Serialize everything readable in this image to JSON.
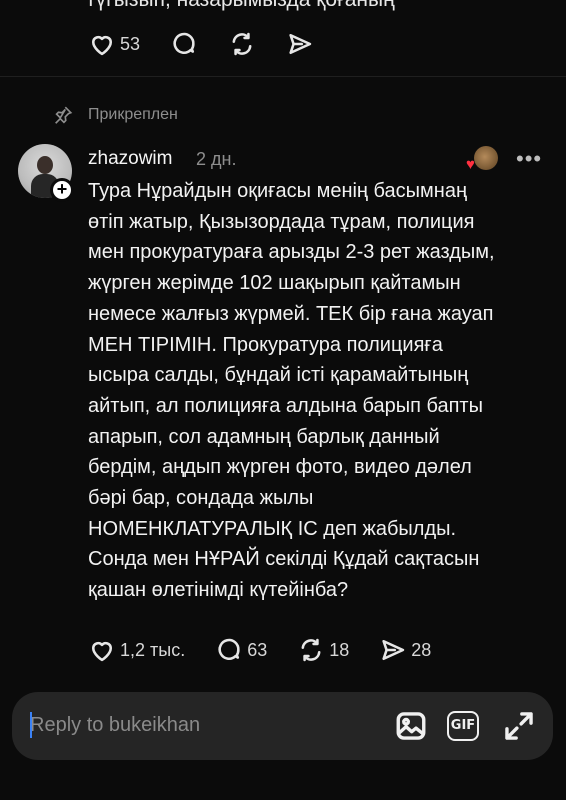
{
  "previous_post": {
    "cut_text": "түгызып, назарымызда қоғаның",
    "likes": "53"
  },
  "pinned_label": "Прикреплен",
  "post": {
    "username": "zhazowim",
    "time": "2 дн.",
    "text": "Тура Нұрайдын оқиғасы менің басымнаң\nөтіп жатыр, Қызызордада тұрам, полиция\nмен прокуратураға арызды 2-3 рет жаздым,\nжүрген жерімде 102 шақырып қайтамын\nнемесе жалғыз жүрмей. ТЕК бір ғана жауап\nМЕН ТІРІМІН. Прокуратура полицияға\nысыра салды, бұндай істі қарамайтының\nайтып, ал полицияға алдына барып бапты\nапарып, сол адамның барлық данный\nбердім, аңдып жүрген фото, видео дәлел\nбәрі бар, сондада жылы\nНОМЕНКЛАТУРАЛЫҚ ІС деп жабылды.\nСонда мен НҰРАЙ секілді Құдай сақтасын\nқашан өлетінімді күтейінба?",
    "likes": "1,2 тыс.",
    "comments": "63",
    "reposts": "18",
    "shares": "28"
  },
  "reply": {
    "placeholder": "Reply to bukeikhan",
    "gif_label": "GIF"
  },
  "icons": [
    "heart-icon",
    "comment-icon",
    "repost-icon",
    "share-icon",
    "pin-icon",
    "more-icon",
    "image-icon",
    "gif-icon",
    "expand-icon"
  ]
}
